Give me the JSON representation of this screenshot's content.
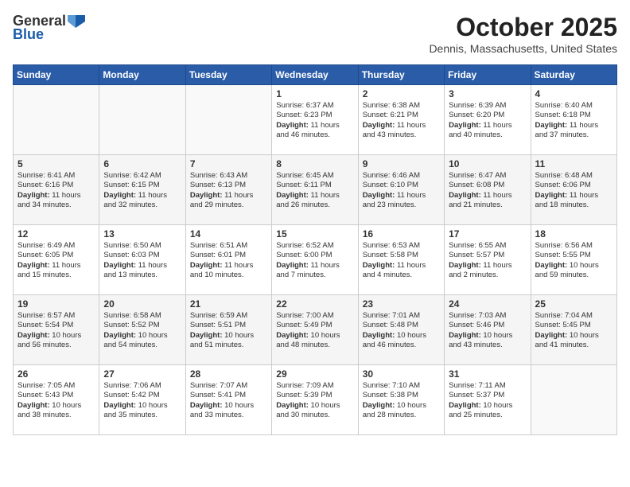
{
  "header": {
    "logo_general": "General",
    "logo_blue": "Blue",
    "month": "October 2025",
    "location": "Dennis, Massachusetts, United States"
  },
  "days_of_week": [
    "Sunday",
    "Monday",
    "Tuesday",
    "Wednesday",
    "Thursday",
    "Friday",
    "Saturday"
  ],
  "weeks": [
    [
      {
        "num": "",
        "text": ""
      },
      {
        "num": "",
        "text": ""
      },
      {
        "num": "",
        "text": ""
      },
      {
        "num": "1",
        "text": "Sunrise: 6:37 AM\nSunset: 6:23 PM\nDaylight: 11 hours and 46 minutes."
      },
      {
        "num": "2",
        "text": "Sunrise: 6:38 AM\nSunset: 6:21 PM\nDaylight: 11 hours and 43 minutes."
      },
      {
        "num": "3",
        "text": "Sunrise: 6:39 AM\nSunset: 6:20 PM\nDaylight: 11 hours and 40 minutes."
      },
      {
        "num": "4",
        "text": "Sunrise: 6:40 AM\nSunset: 6:18 PM\nDaylight: 11 hours and 37 minutes."
      }
    ],
    [
      {
        "num": "5",
        "text": "Sunrise: 6:41 AM\nSunset: 6:16 PM\nDaylight: 11 hours and 34 minutes."
      },
      {
        "num": "6",
        "text": "Sunrise: 6:42 AM\nSunset: 6:15 PM\nDaylight: 11 hours and 32 minutes."
      },
      {
        "num": "7",
        "text": "Sunrise: 6:43 AM\nSunset: 6:13 PM\nDaylight: 11 hours and 29 minutes."
      },
      {
        "num": "8",
        "text": "Sunrise: 6:45 AM\nSunset: 6:11 PM\nDaylight: 11 hours and 26 minutes."
      },
      {
        "num": "9",
        "text": "Sunrise: 6:46 AM\nSunset: 6:10 PM\nDaylight: 11 hours and 23 minutes."
      },
      {
        "num": "10",
        "text": "Sunrise: 6:47 AM\nSunset: 6:08 PM\nDaylight: 11 hours and 21 minutes."
      },
      {
        "num": "11",
        "text": "Sunrise: 6:48 AM\nSunset: 6:06 PM\nDaylight: 11 hours and 18 minutes."
      }
    ],
    [
      {
        "num": "12",
        "text": "Sunrise: 6:49 AM\nSunset: 6:05 PM\nDaylight: 11 hours and 15 minutes."
      },
      {
        "num": "13",
        "text": "Sunrise: 6:50 AM\nSunset: 6:03 PM\nDaylight: 11 hours and 13 minutes."
      },
      {
        "num": "14",
        "text": "Sunrise: 6:51 AM\nSunset: 6:01 PM\nDaylight: 11 hours and 10 minutes."
      },
      {
        "num": "15",
        "text": "Sunrise: 6:52 AM\nSunset: 6:00 PM\nDaylight: 11 hours and 7 minutes."
      },
      {
        "num": "16",
        "text": "Sunrise: 6:53 AM\nSunset: 5:58 PM\nDaylight: 11 hours and 4 minutes."
      },
      {
        "num": "17",
        "text": "Sunrise: 6:55 AM\nSunset: 5:57 PM\nDaylight: 11 hours and 2 minutes."
      },
      {
        "num": "18",
        "text": "Sunrise: 6:56 AM\nSunset: 5:55 PM\nDaylight: 10 hours and 59 minutes."
      }
    ],
    [
      {
        "num": "19",
        "text": "Sunrise: 6:57 AM\nSunset: 5:54 PM\nDaylight: 10 hours and 56 minutes."
      },
      {
        "num": "20",
        "text": "Sunrise: 6:58 AM\nSunset: 5:52 PM\nDaylight: 10 hours and 54 minutes."
      },
      {
        "num": "21",
        "text": "Sunrise: 6:59 AM\nSunset: 5:51 PM\nDaylight: 10 hours and 51 minutes."
      },
      {
        "num": "22",
        "text": "Sunrise: 7:00 AM\nSunset: 5:49 PM\nDaylight: 10 hours and 48 minutes."
      },
      {
        "num": "23",
        "text": "Sunrise: 7:01 AM\nSunset: 5:48 PM\nDaylight: 10 hours and 46 minutes."
      },
      {
        "num": "24",
        "text": "Sunrise: 7:03 AM\nSunset: 5:46 PM\nDaylight: 10 hours and 43 minutes."
      },
      {
        "num": "25",
        "text": "Sunrise: 7:04 AM\nSunset: 5:45 PM\nDaylight: 10 hours and 41 minutes."
      }
    ],
    [
      {
        "num": "26",
        "text": "Sunrise: 7:05 AM\nSunset: 5:43 PM\nDaylight: 10 hours and 38 minutes."
      },
      {
        "num": "27",
        "text": "Sunrise: 7:06 AM\nSunset: 5:42 PM\nDaylight: 10 hours and 35 minutes."
      },
      {
        "num": "28",
        "text": "Sunrise: 7:07 AM\nSunset: 5:41 PM\nDaylight: 10 hours and 33 minutes."
      },
      {
        "num": "29",
        "text": "Sunrise: 7:09 AM\nSunset: 5:39 PM\nDaylight: 10 hours and 30 minutes."
      },
      {
        "num": "30",
        "text": "Sunrise: 7:10 AM\nSunset: 5:38 PM\nDaylight: 10 hours and 28 minutes."
      },
      {
        "num": "31",
        "text": "Sunrise: 7:11 AM\nSunset: 5:37 PM\nDaylight: 10 hours and 25 minutes."
      },
      {
        "num": "",
        "text": ""
      }
    ]
  ]
}
